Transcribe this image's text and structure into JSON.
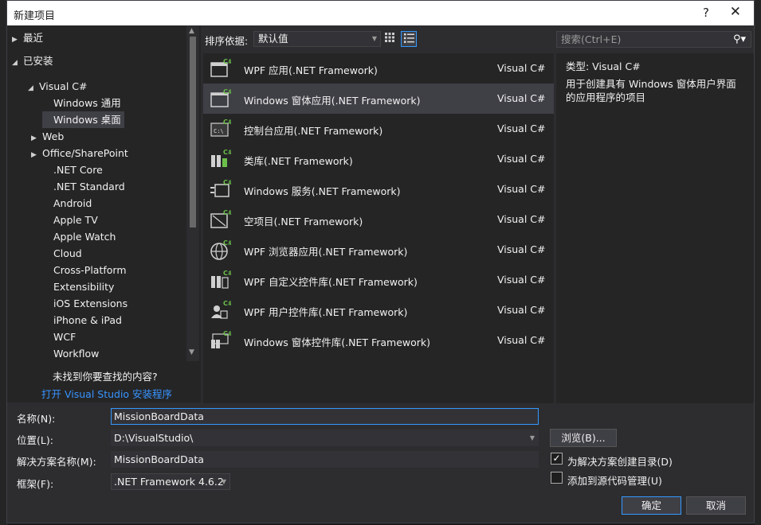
{
  "window": {
    "title": "新建项目",
    "help": "?",
    "close": "✕"
  },
  "tree": {
    "items": [
      {
        "label": "最近",
        "arrow": "▶"
      },
      {
        "label": "已安装",
        "arrow": "◢"
      },
      {
        "label": "Visual C#",
        "arrow": "◢"
      },
      {
        "label": "Windows 通用",
        "arrow": ""
      },
      {
        "label": "Windows 桌面",
        "arrow": ""
      },
      {
        "label": "Web",
        "arrow": "▶"
      },
      {
        "label": "Office/SharePoint",
        "arrow": "▶"
      },
      {
        "label": ".NET Core",
        "arrow": ""
      },
      {
        "label": ".NET Standard",
        "arrow": ""
      },
      {
        "label": "Android",
        "arrow": ""
      },
      {
        "label": "Apple TV",
        "arrow": ""
      },
      {
        "label": "Apple Watch",
        "arrow": ""
      },
      {
        "label": "Cloud",
        "arrow": ""
      },
      {
        "label": "Cross-Platform",
        "arrow": ""
      },
      {
        "label": "Extensibility",
        "arrow": ""
      },
      {
        "label": "iOS Extensions",
        "arrow": ""
      },
      {
        "label": "iPhone & iPad",
        "arrow": ""
      },
      {
        "label": "WCF",
        "arrow": ""
      },
      {
        "label": "Workflow",
        "arrow": ""
      }
    ],
    "selected": "Windows 桌面",
    "not_found": "未找到你要查找的内容?",
    "open_installer": "打开 Visual Studio 安装程序"
  },
  "toolbar": {
    "sort_label": "排序依据:",
    "sort_value": "默认值"
  },
  "templates": [
    {
      "name": "WPF 应用(.NET Framework)",
      "lang": "Visual C#",
      "icon": "wpf-app-icon"
    },
    {
      "name": "Windows 窗体应用(.NET Framework)",
      "lang": "Visual C#",
      "icon": "windows-forms-app-icon"
    },
    {
      "name": "控制台应用(.NET Framework)",
      "lang": "Visual C#",
      "icon": "console-app-icon"
    },
    {
      "name": "类库(.NET Framework)",
      "lang": "Visual C#",
      "icon": "class-library-icon"
    },
    {
      "name": "Windows 服务(.NET Framework)",
      "lang": "Visual C#",
      "icon": "windows-service-icon"
    },
    {
      "name": "空项目(.NET Framework)",
      "lang": "Visual C#",
      "icon": "empty-project-icon"
    },
    {
      "name": "WPF 浏览器应用(.NET Framework)",
      "lang": "Visual C#",
      "icon": "wpf-browser-app-icon"
    },
    {
      "name": "WPF 自定义控件库(.NET Framework)",
      "lang": "Visual C#",
      "icon": "wpf-custom-control-library-icon"
    },
    {
      "name": "WPF 用户控件库(.NET Framework)",
      "lang": "Visual C#",
      "icon": "wpf-user-control-library-icon"
    },
    {
      "name": "Windows 窗体控件库(.NET Framework)",
      "lang": "Visual C#",
      "icon": "windows-forms-control-library-icon"
    }
  ],
  "selected_template": "Windows 窗体应用(.NET Framework)",
  "search": {
    "placeholder": "搜索(Ctrl+E)"
  },
  "description": {
    "type_line": "类型:  Visual C#",
    "text": "用于创建具有 Windows 窗体用户界面的应用程序的项目"
  },
  "form": {
    "name_label": "名称(N):",
    "name_value": "MissionBoardData",
    "location_label": "位置(L):",
    "location_value": "D:\\VisualStudio\\",
    "solution_label": "解决方案名称(M):",
    "solution_value": "MissionBoardData",
    "framework_label": "框架(F):",
    "framework_value": ".NET Framework 4.6.2",
    "browse_label": "浏览(B)...",
    "create_dir_label": "为解决方案创建目录(D)",
    "create_dir_checked": true,
    "source_control_label": "添加到源代码管理(U)",
    "source_control_checked": false,
    "ok_label": "确定",
    "cancel_label": "取消"
  },
  "colors": {
    "accent": "#3399ff",
    "link": "#3794ff",
    "background": "#2d2d30"
  }
}
